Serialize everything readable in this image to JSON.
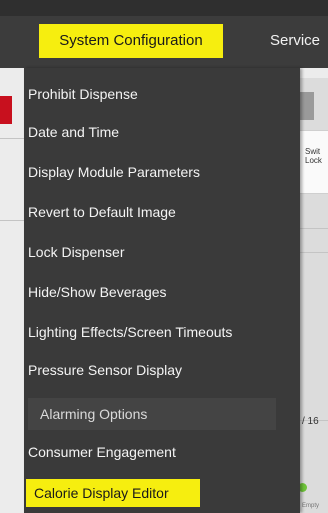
{
  "header": {
    "active_tab": "System Configuration",
    "service_tab": "Service"
  },
  "menu": {
    "items": [
      "Prohibit Dispense",
      "Date and Time",
      "Display Module Parameters",
      "Revert to Default Image",
      "Lock Dispenser",
      "Hide/Show Beverages",
      "Lighting Effects/Screen Timeouts",
      "Pressure Sensor Display"
    ],
    "submenu_label": "Alarming Options",
    "after_sub": "Consumer Engagement",
    "highlighted": "Calorie Display Editor"
  },
  "background": {
    "card_line1": "Swit",
    "card_line2": "Lock",
    "counter": "/ 16",
    "status_label": "Empty"
  },
  "colors": {
    "highlight": "#f6ee0f",
    "menu_bg": "#3a3a3a",
    "topbar_bg": "#3c3c3c",
    "accent_red": "#c8101e",
    "status_green": "#6fc43a"
  }
}
